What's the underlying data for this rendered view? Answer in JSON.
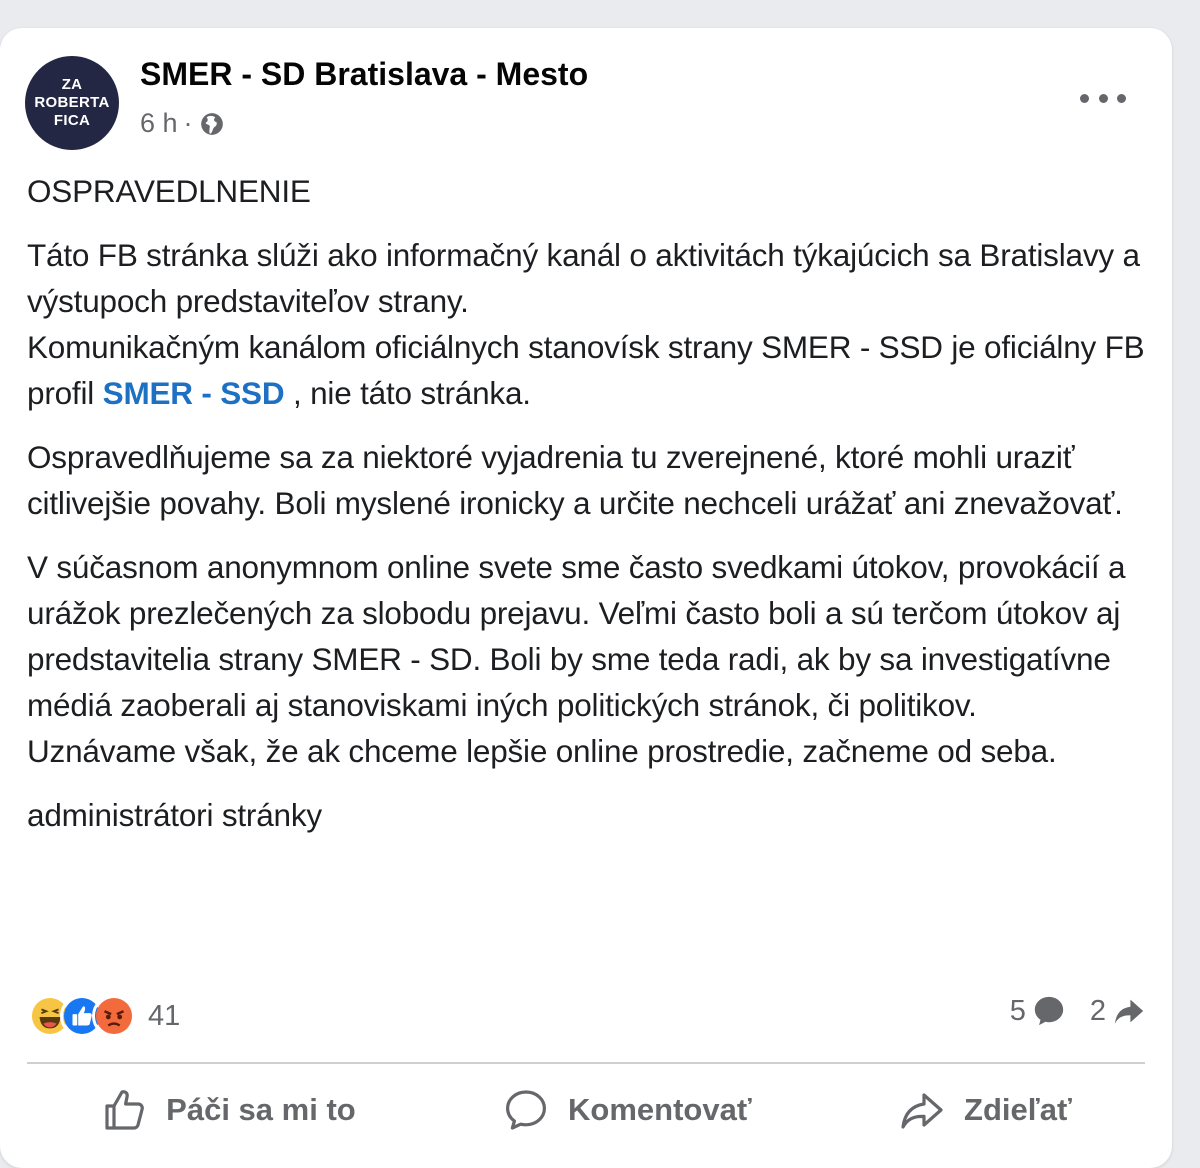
{
  "post": {
    "page_name": "SMER - SD Bratislava - Mesto",
    "avatar_lines": [
      "ZA",
      "ROBERTA",
      "FICA"
    ],
    "time": "6 h",
    "time_sep": "·",
    "paragraphs": {
      "p1": "OSPRAVEDLNENIE",
      "p2a": "Táto FB stránka slúži ako informačný kanál o aktivitách týkajúcich sa Bratislavy a výstupoch predstaviteľov strany.",
      "p2b": "Komunikačným kanálom oficiálnych stanovísk strany SMER - SSD je oficiálny FB profil",
      "p2_mention": "SMER - SSD",
      "p2c": ", nie táto stránka.",
      "p3": "Ospravedlňujeme sa za niektoré vyjadrenia tu zverejnené, ktoré mohli uraziť citlivejšie povahy. Boli myslené ironicky a určite nechceli urážať ani znevažovať.",
      "p4a": "V súčasnom anonymnom online svete sme často svedkami útokov, provokácií a urážok prezlečených za slobodu prejavu. Veľmi často boli a sú terčom útokov aj predstavitelia strany SMER - SD. Boli by sme teda radi, ak by sa investigatívne médiá zaoberali aj stanoviskami iných politických stránok, či politikov.",
      "p4b": "Uznávame však, že ak chceme lepšie online prostredie, začneme od seba.",
      "p5": "administrátori stránky"
    },
    "reactions": {
      "types": [
        "haha",
        "like",
        "angry"
      ],
      "count": "41"
    },
    "comments_count": "5",
    "shares_count": "2"
  },
  "actions": {
    "like_label": "Páči sa mi to",
    "comment_label": "Komentovať",
    "share_label": "Zdieľať"
  },
  "colors": {
    "avatar_bg": "#242744",
    "mention": "#1d70c2",
    "muted": "#65676b",
    "like_blue": "#1877f2",
    "angry_orange": "#f36b3c",
    "haha_yellow": "#f7c544"
  }
}
